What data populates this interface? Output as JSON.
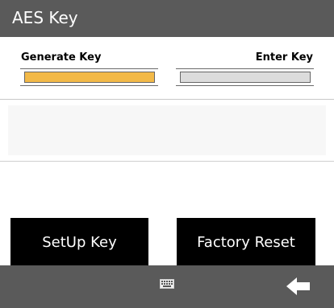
{
  "window": {
    "title": "AES Key"
  },
  "tabs": [
    {
      "label": "Generate Key",
      "state": "selected",
      "color": "#f2b948"
    },
    {
      "label": "Enter Key",
      "state": "unselected",
      "color": "#dcdcdc"
    }
  ],
  "display": {
    "value": ""
  },
  "actions": {
    "setup_label": "SetUp Key",
    "reset_label": "Factory Reset"
  },
  "bottom_bar": {
    "keyboard_icon": "keyboard-icon",
    "back_icon": "back-arrow-icon"
  }
}
